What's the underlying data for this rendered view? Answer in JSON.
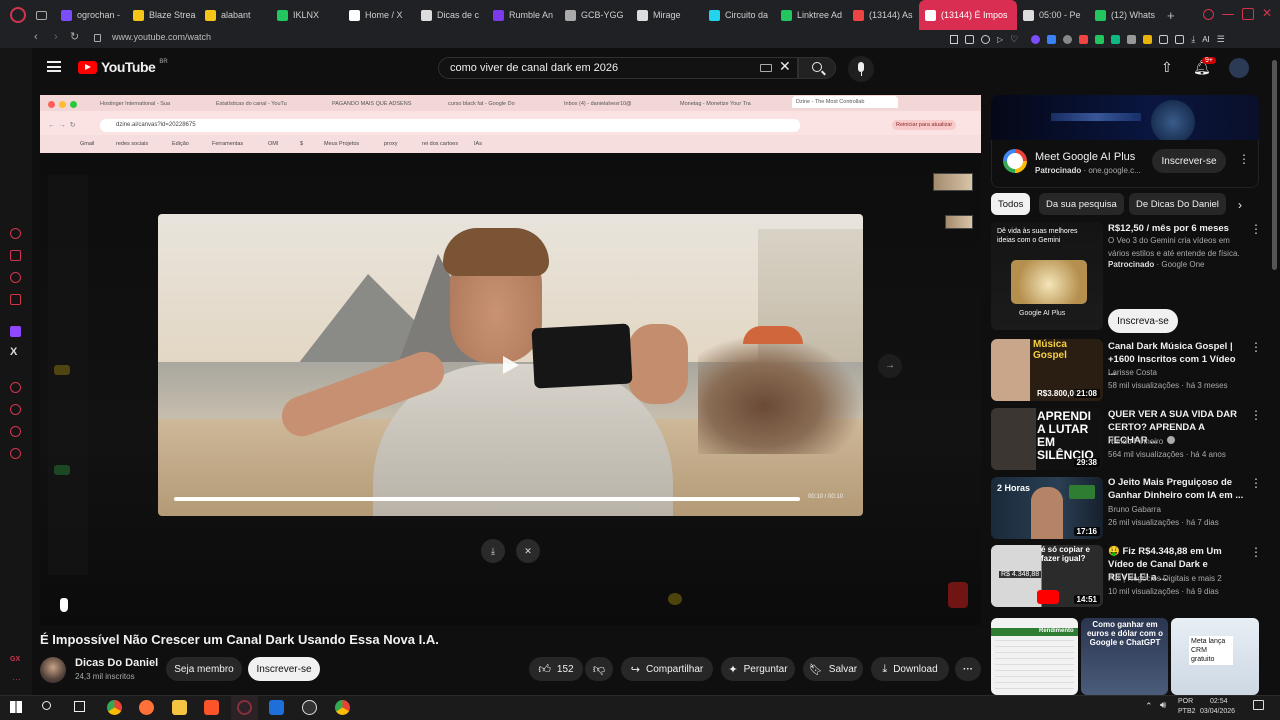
{
  "browser": {
    "tabs": [
      {
        "label": "ogrochan -",
        "color": "#7c4dff"
      },
      {
        "label": "Blaze Strea",
        "color": "#f5c518"
      },
      {
        "label": "alabant",
        "color": "#f5c518"
      },
      {
        "label": "IKLNX",
        "color": "#22c55e"
      },
      {
        "label": "Home / X",
        "color": "#ffffff"
      },
      {
        "label": "Dicas de c",
        "color": "#dddddd"
      },
      {
        "label": "Rumble An",
        "color": "#7c3aed"
      },
      {
        "label": "GCB-YGG",
        "color": "#aaaaaa"
      },
      {
        "label": "Mirage",
        "color": "#dddddd"
      },
      {
        "label": "Circuito da",
        "color": "#22d3ee"
      },
      {
        "label": "Linktree Ad",
        "color": "#22c55e"
      },
      {
        "label": "(13144) As",
        "color": "#ef4444"
      },
      {
        "label": "(13144) É Impos",
        "color": "#ffffff"
      },
      {
        "label": "05:00 - Pe",
        "color": "#dddddd"
      },
      {
        "label": "(12) Whats",
        "color": "#22c55e"
      }
    ],
    "url": "www.youtube.com/watch",
    "ai_label": "AI"
  },
  "youtube": {
    "logo_text": "YouTube",
    "region": "BR",
    "search_value": "como viver de canal dark em 2026",
    "notif_count": "9+",
    "avatar_letter": "●"
  },
  "player": {
    "inner_tabs": [
      "Hostinger International - Sua",
      "Estatísticas do canal - YouTu",
      "PAGANDO MAIS QUE ADSENS",
      "curso black fat - Google Do",
      "Inbox (4) - danielalvesr10@",
      "Monetag - Monetize Your Tra",
      "Dzine - The Most Controllab"
    ],
    "inner_url": "dzine.ai/canvas?id=20228675",
    "inner_update": "Reiniciar para atualizar",
    "bookmarks": [
      "Gmail",
      "redes sociais",
      "Edição",
      "Ferramentas",
      "OMI",
      "$",
      "Meus Projetos",
      "proxy",
      "rei dos cartoes",
      "IAs"
    ],
    "time": "00:10 / 00:10",
    "progress": 1.0
  },
  "video": {
    "title": "É Impossível Não Crescer um Canal Dark Usando Essa Nova I.A.",
    "channel": "Dicas Do Daniel",
    "subscribers": "24,3 mil inscritos",
    "join_label": "Seja membro",
    "subscribe_label": "Inscrever-se",
    "likes": "152",
    "share_label": "Compartilhar",
    "ask_label": "Perguntar",
    "save_label": "Salvar",
    "download_label": "Download"
  },
  "sidebar": {
    "ad": {
      "title": "Meet Google AI Plus",
      "sponsored": "Patrocinado",
      "domain": "one.google.c...",
      "cta": "Inscrever-se"
    },
    "chips": [
      "Todos",
      "Da sua pesquisa",
      "De Dicas Do Daniel"
    ],
    "promo": {
      "title": "R$12,50 / mês por 6 meses",
      "desc": "O Veo 3 do Gemini cria vídeos em vários estilos e até entende de física.",
      "sponsored": "Patrocinado",
      "advertiser": "Google One",
      "cta": "Inscreva-se",
      "thumb_text": "Dê vida às suas melhores ideias com o Gemini",
      "thumb_brand": "Google AI Plus"
    },
    "recs": [
      {
        "title": "Canal Dark Música Gospel | +1600 Inscritos com 1 Vídeo ...",
        "channel": "Larisse Costa",
        "meta": "58 mil visualizações · há 3 meses",
        "duration": "21:08",
        "thumb_text": "Música Gospel",
        "thumb_sub": "R$3.800,00"
      },
      {
        "title": "QUER VER A SUA VIDA DAR CERTO? APRENDA A FECHAR ...",
        "channel": "Nando Pinheiro",
        "meta": "564 mil visualizações · há 4 anos",
        "duration": "29:38",
        "thumb_text": "APRENDI A LUTAR EM SILÊNCIO"
      },
      {
        "title": "O Jeito Mais Preguiçoso de Ganhar Dinheiro com IA em ...",
        "channel": "Bruno Gabarra",
        "meta": "26 mil visualizações · há 7 dias",
        "duration": "17:16",
        "thumb_text": "2 Horas"
      },
      {
        "title": "🤑 Fiz R$4.348,88 em Um Vídeo de Canal Dark e REVELEI a ...",
        "channel": "Full | Negócios Digitais e mais 2",
        "meta": "10 mil visualizações · há 9 dias",
        "duration": "14:51",
        "thumb_text": "é só copiar e fazer igual?",
        "thumb_sub": "R$ 4.348,88"
      }
    ],
    "shorts": [
      {
        "text": "Rendimento"
      },
      {
        "text": "Como ganhar em euros e dólar com o Google e ChatGPT"
      },
      {
        "text": "Meta lança CRM gratuito"
      }
    ]
  },
  "taskbar": {
    "lang": "POR",
    "layout": "PTB2",
    "time": "02:54",
    "date": "03/04/2026"
  }
}
